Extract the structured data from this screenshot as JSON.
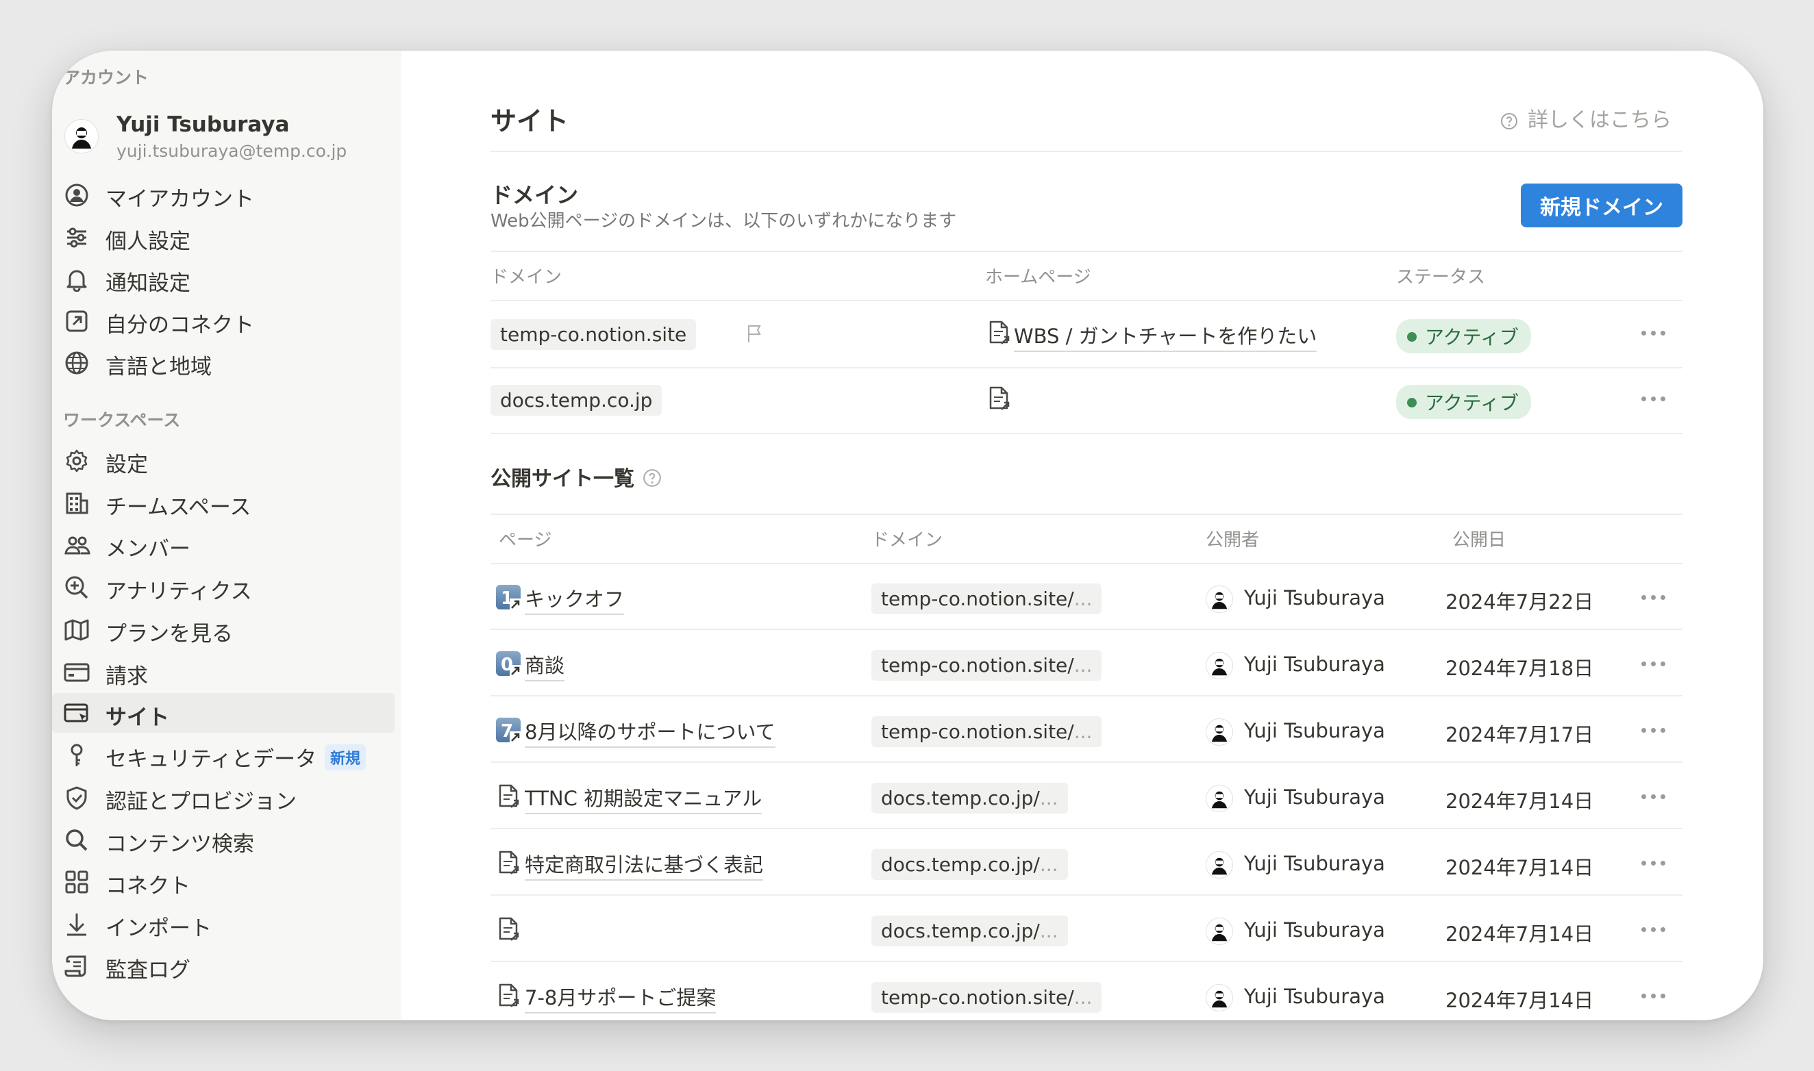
{
  "sidebar": {
    "account_section": "アカウント",
    "user_name": "Yuji Tsuburaya",
    "user_email": "yuji.tsuburaya@temp.co.jp",
    "account_items": [
      {
        "label": "マイアカウント",
        "icon": "user-circle-icon"
      },
      {
        "label": "個人設定",
        "icon": "sliders-icon"
      },
      {
        "label": "通知設定",
        "icon": "bell-icon"
      },
      {
        "label": "自分のコネクト",
        "icon": "arrow-out-square-icon"
      },
      {
        "label": "言語と地域",
        "icon": "globe-icon"
      }
    ],
    "workspace_section": "ワークスペース",
    "workspace_items": [
      {
        "label": "設定",
        "icon": "gear-icon"
      },
      {
        "label": "チームスペース",
        "icon": "building-icon"
      },
      {
        "label": "メンバー",
        "icon": "people-icon"
      },
      {
        "label": "アナリティクス",
        "icon": "zoom-analytics-icon"
      },
      {
        "label": "プランを見る",
        "icon": "map-icon"
      },
      {
        "label": "請求",
        "icon": "credit-card-icon"
      },
      {
        "label": "サイト",
        "icon": "browser-cursor-icon",
        "active": true
      },
      {
        "label": "セキュリティとデータ",
        "icon": "key-icon",
        "badge": "新規"
      },
      {
        "label": "認証とプロビジョン",
        "icon": "shield-check-icon"
      },
      {
        "label": "コンテンツ検索",
        "icon": "search-icon"
      },
      {
        "label": "コネクト",
        "icon": "grid-icon"
      },
      {
        "label": "インポート",
        "icon": "download-arrow-icon"
      },
      {
        "label": "監査ログ",
        "icon": "scroll-icon"
      }
    ]
  },
  "main": {
    "title": "サイト",
    "learn_more": "詳しくはこちら",
    "domains": {
      "title": "ドメイン",
      "subtitle": "Web公開ページのドメインは、以下のいずれかになります",
      "new_button": "新規ドメイン",
      "headers": {
        "domain": "ドメイン",
        "homepage": "ホームページ",
        "status": "ステータス"
      },
      "rows": [
        {
          "domain": "temp-co.notion.site",
          "homepage": "WBS / ガントチャートを作りたい",
          "status": "アクティブ"
        },
        {
          "domain": "docs.temp.co.jp",
          "homepage": "",
          "status": "アクティブ"
        }
      ]
    },
    "published": {
      "title": "公開サイト一覧",
      "headers": {
        "page": "ページ",
        "domain": "ドメイン",
        "publisher": "公開者",
        "date": "公開日"
      },
      "rows": [
        {
          "page": "キックオフ",
          "icon": "number-1",
          "domain": "temp-co.notion.site/",
          "ellipsis": "...",
          "publisher": "Yuji Tsuburaya",
          "date": "2024年7月22日"
        },
        {
          "page": "商談",
          "icon": "number-0",
          "domain": "temp-co.notion.site/",
          "ellipsis": "...",
          "publisher": "Yuji Tsuburaya",
          "date": "2024年7月18日"
        },
        {
          "page": "8月以降のサポートについて",
          "icon": "number-7",
          "domain": "temp-co.notion.site/",
          "ellipsis": "...",
          "publisher": "Yuji Tsuburaya",
          "date": "2024年7月17日"
        },
        {
          "page": "TTNC 初期設定マニュアル",
          "icon": "doc",
          "domain": "docs.temp.co.jp/",
          "ellipsis": "...",
          "publisher": "Yuji Tsuburaya",
          "date": "2024年7月14日"
        },
        {
          "page": "特定商取引法に基づく表記",
          "icon": "doc",
          "domain": "docs.temp.co.jp/",
          "ellipsis": "...",
          "publisher": "Yuji Tsuburaya",
          "date": "2024年7月14日"
        },
        {
          "page": "",
          "icon": "doc",
          "domain": "docs.temp.co.jp/",
          "ellipsis": "...",
          "publisher": "Yuji Tsuburaya",
          "date": "2024年7月14日"
        },
        {
          "page": "7-8月サポートご提案",
          "icon": "doc",
          "domain": "temp-co.notion.site/",
          "ellipsis": "...",
          "publisher": "Yuji Tsuburaya",
          "date": "2024年7月14日"
        }
      ]
    }
  },
  "colors": {
    "accent": "#2e83dd",
    "status_bg": "#e0f1e4",
    "status_fg": "#2c6b3e",
    "sidebar_bg": "#f7f7f5"
  }
}
